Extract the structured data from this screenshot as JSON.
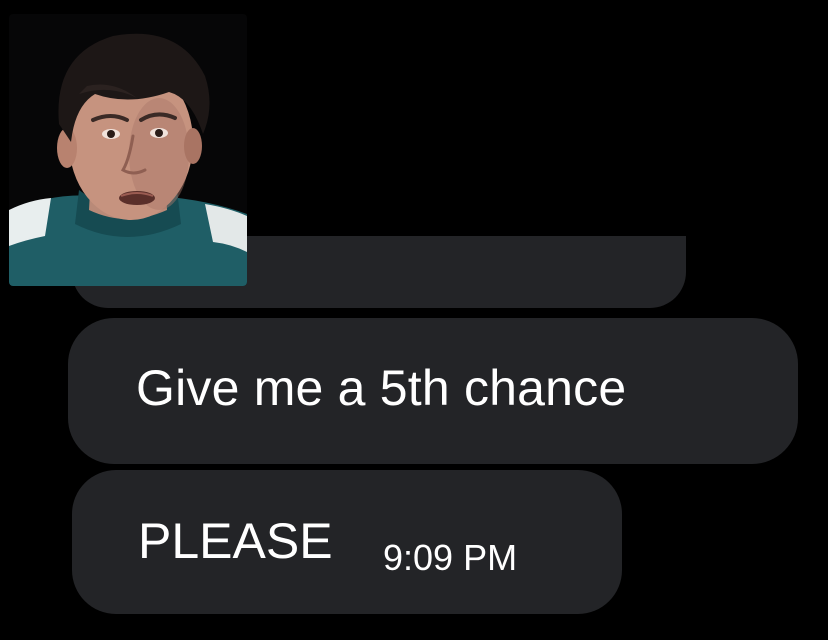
{
  "conversation": {
    "messages": [
      {
        "text": "Give me a 5th chance"
      },
      {
        "text": "PLEASE",
        "time": "9:09 PM"
      }
    ]
  },
  "avatar": {
    "icon": "person-avatar-icon"
  },
  "colors": {
    "background": "#000000",
    "bubble": "#232427",
    "text": "#ffffff"
  }
}
